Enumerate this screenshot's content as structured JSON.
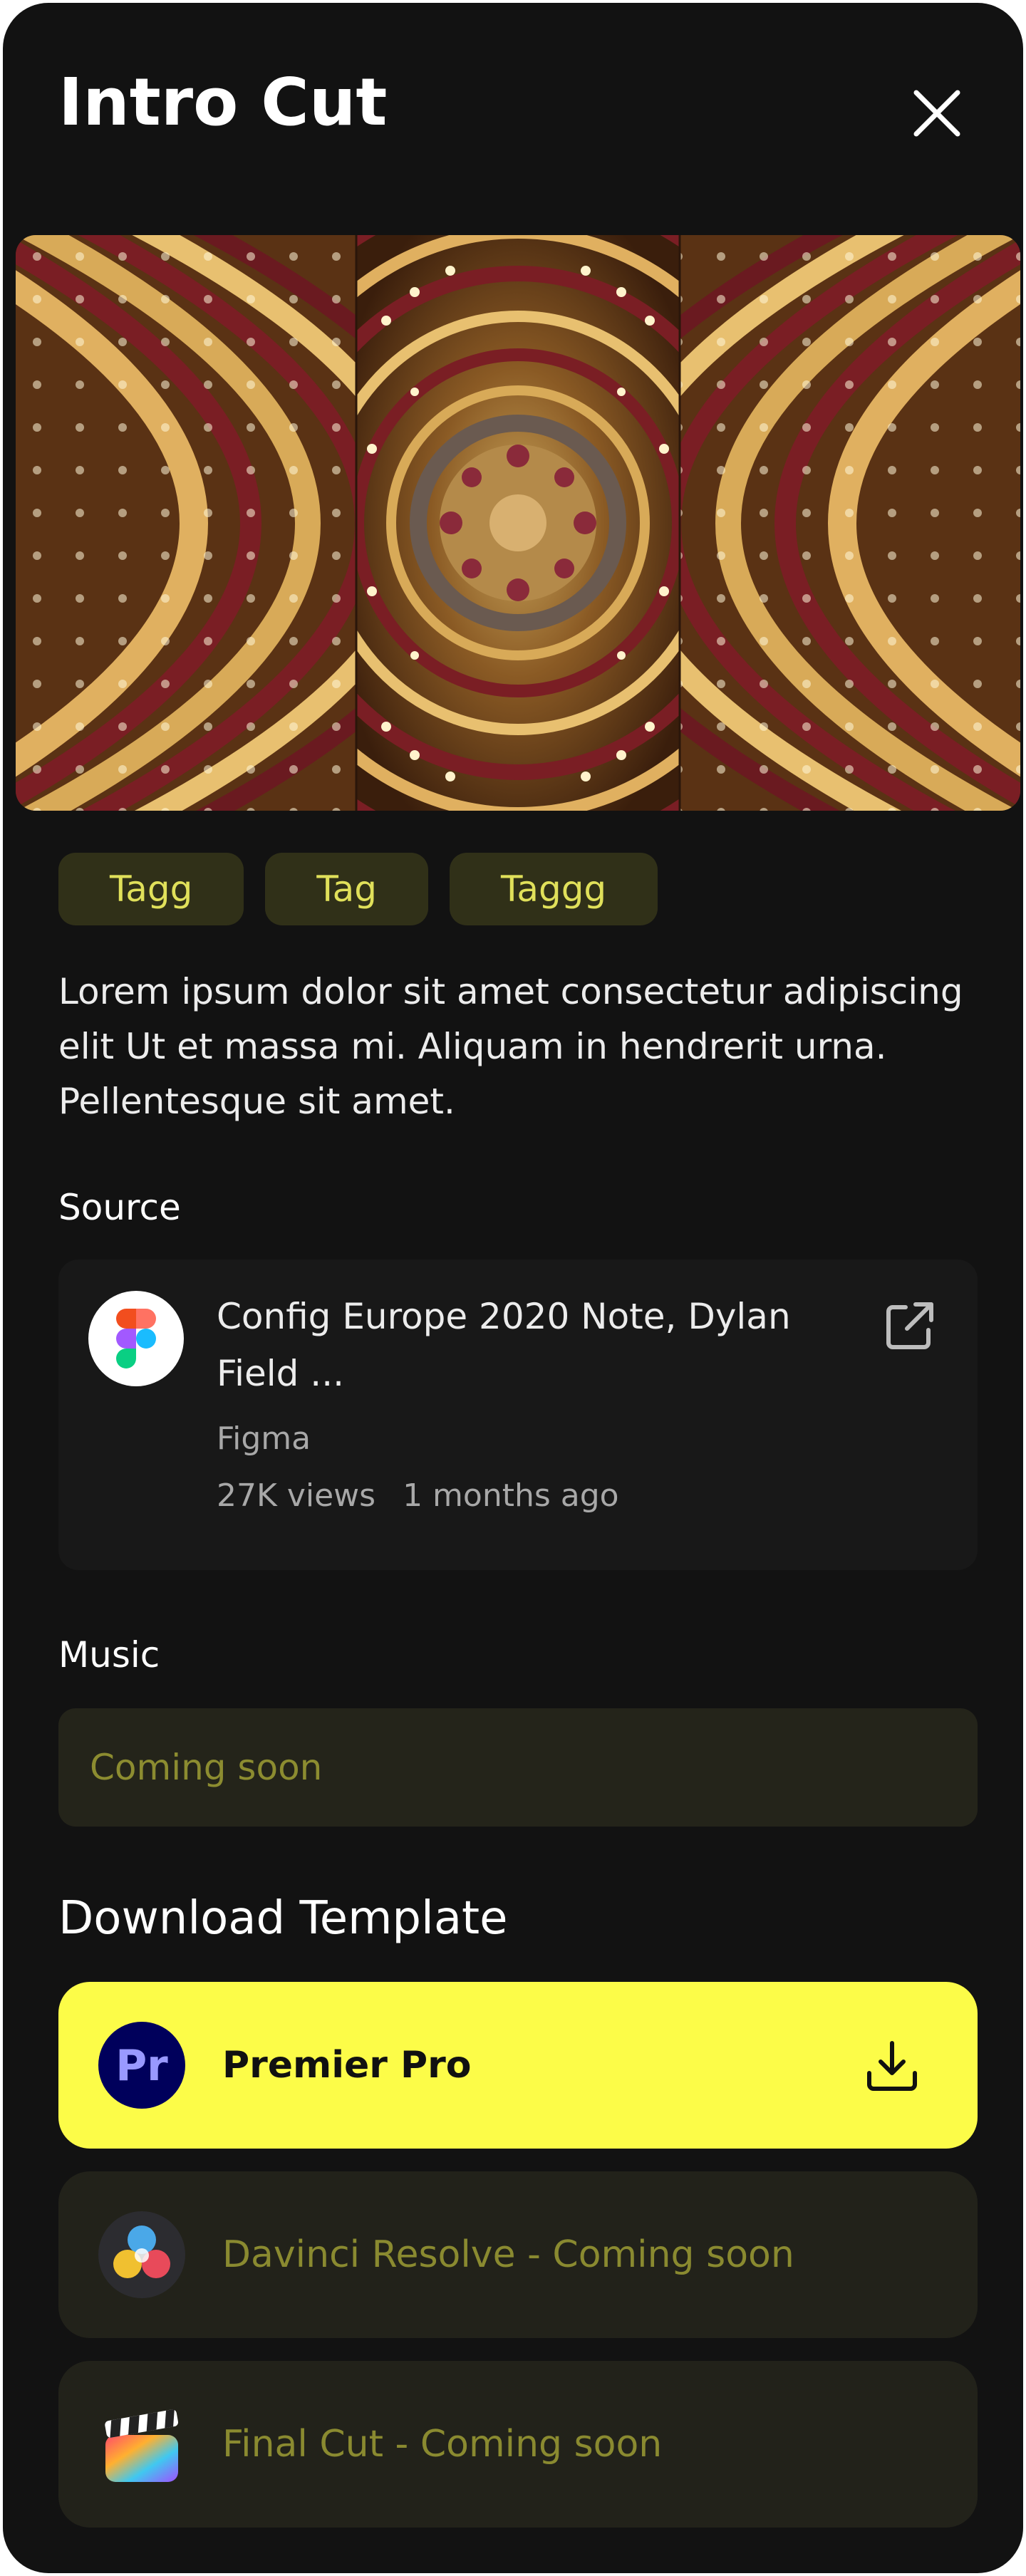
{
  "header": {
    "title": "Intro Cut",
    "close_icon": "close-icon"
  },
  "hero": {
    "image": "theater-ceiling-photo-collage"
  },
  "tags": [
    "Tagg",
    "Tag",
    "Taggg"
  ],
  "description": "Lorem ipsum dolor sit amet consectetur adipiscing elit Ut et massa mi. Aliquam in hendrerit urna. Pellentesque sit amet.",
  "source": {
    "label": "Source",
    "title": "Config Europe 2020 Note, Dylan Field ...",
    "channel": "Figma",
    "views": "27K views",
    "age": "1 months ago",
    "logo_icon": "figma-icon",
    "link_icon": "external-link-icon"
  },
  "music": {
    "label": "Music",
    "value": "Coming soon"
  },
  "download": {
    "title": "Download Template",
    "options": [
      {
        "label": "Premier Pro",
        "icon": "premiere-pro-icon",
        "action_icon": "download-icon",
        "state": "active"
      },
      {
        "label": "Davinci Resolve - Coming soon",
        "icon": "davinci-resolve-icon",
        "state": "disabled"
      },
      {
        "label": "Final Cut - Coming soon",
        "icon": "final-cut-icon",
        "state": "disabled"
      }
    ]
  },
  "colors": {
    "background": "#121212",
    "accent": "#fcfc48",
    "tag_bg": "#303018",
    "tag_text": "#e0e05a",
    "card_bg": "#181818",
    "muted_text": "#8a8a30"
  }
}
